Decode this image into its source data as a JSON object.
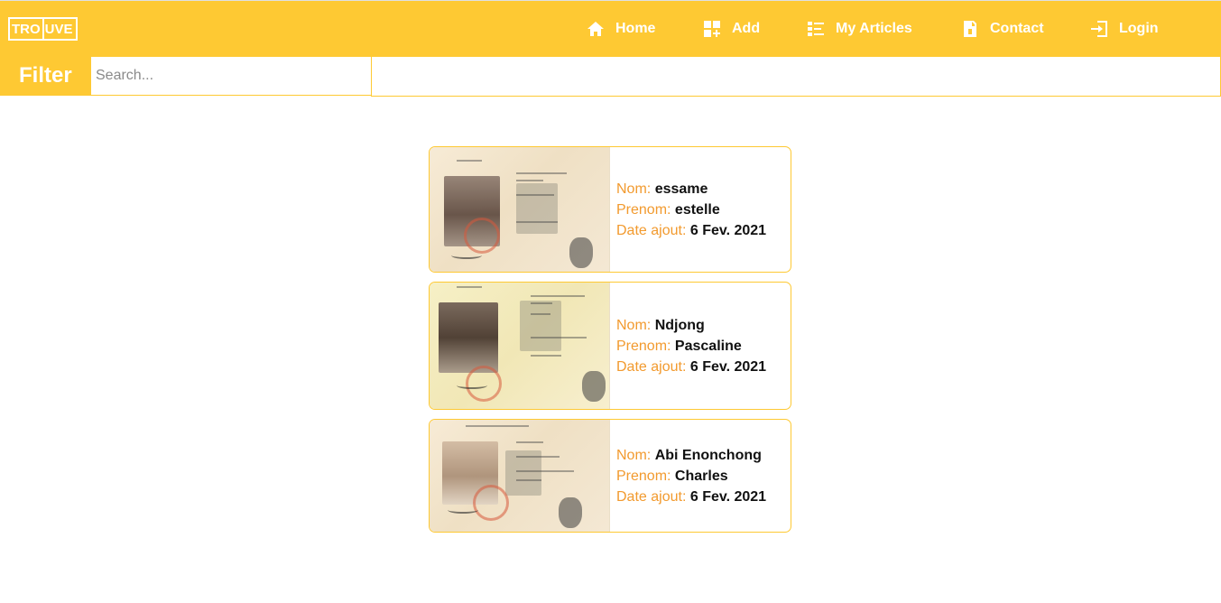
{
  "brand": {
    "logo_part1": "TRO",
    "logo_part2": "UVE"
  },
  "nav": {
    "home": {
      "label": "Home",
      "icon": "home-icon"
    },
    "add": {
      "label": "Add",
      "icon": "add-grid-icon"
    },
    "articles": {
      "label": "My Articles",
      "icon": "list-icon"
    },
    "contact": {
      "label": "Contact",
      "icon": "contact-card-icon"
    },
    "login": {
      "label": "Login",
      "icon": "login-icon"
    }
  },
  "filter": {
    "label": "Filter",
    "placeholder": "Search...",
    "value": ""
  },
  "labels": {
    "nom": "Nom:",
    "prenom": "Prenom:",
    "date": "Date ajout:"
  },
  "articles": [
    {
      "nom": "essame",
      "prenom": "estelle",
      "date": "6 Fev. 2021"
    },
    {
      "nom": "Ndjong",
      "prenom": "Pascaline",
      "date": "6 Fev. 2021"
    },
    {
      "nom": "Abi Enonchong",
      "prenom": "Charles",
      "date": "6 Fev. 2021"
    }
  ],
  "colors": {
    "accent": "#fec933",
    "label": "#f29a2e",
    "text": "#111111"
  }
}
